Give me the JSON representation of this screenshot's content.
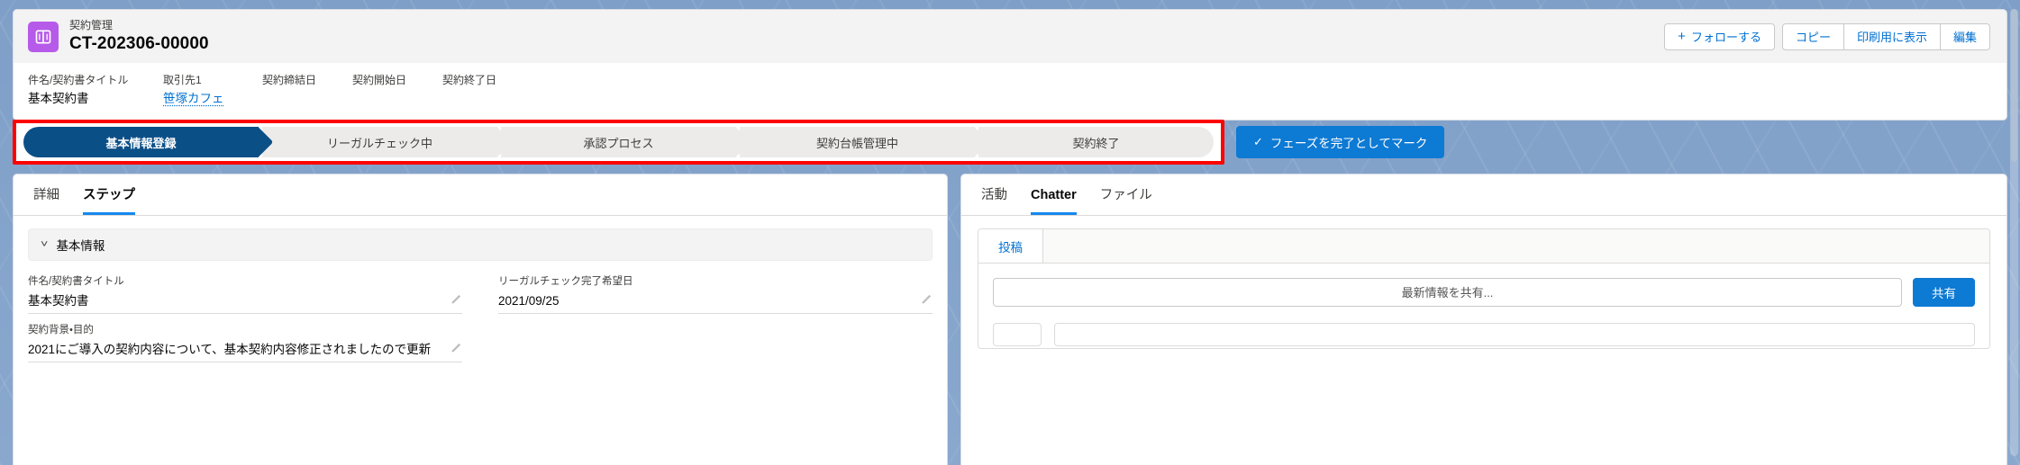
{
  "header": {
    "object_label": "契約管理",
    "record_name": "CT-202306-00000",
    "app_icon": "book-icon",
    "icon_color": "#b65ae9",
    "actions": {
      "follow": "フォローする",
      "follow_icon": "plus-icon",
      "copy": "コピー",
      "printable_view": "印刷用に表示",
      "edit": "編集"
    },
    "fields": [
      {
        "label": "件名/契約書タイトル",
        "value": "基本契約書",
        "is_link": false
      },
      {
        "label": "取引先1",
        "value": "笹塚カフェ",
        "is_link": true
      },
      {
        "label": "契約締結日",
        "value": "",
        "is_link": false
      },
      {
        "label": "契約開始日",
        "value": "",
        "is_link": false
      },
      {
        "label": "契約終了日",
        "value": "",
        "is_link": false
      }
    ]
  },
  "path": {
    "highlight_color": "#ff0000",
    "current_color": "#0b4f87",
    "stages": [
      {
        "label": "基本情報登録",
        "state": "current"
      },
      {
        "label": "リーガルチェック中",
        "state": "upcoming"
      },
      {
        "label": "承認プロセス",
        "state": "upcoming"
      },
      {
        "label": "契約台帳管理中",
        "state": "upcoming"
      },
      {
        "label": "契約終了",
        "state": "upcoming"
      }
    ],
    "mark_complete_label": "フェーズを完了としてマーク",
    "mark_complete_icon": "check-icon",
    "mark_complete_color": "#0d7ad4"
  },
  "left_panel": {
    "tabs": [
      {
        "label": "詳細",
        "active": false
      },
      {
        "label": "ステップ",
        "active": true
      }
    ],
    "section": {
      "title": "基本情報",
      "caret_icon": "chevron-down-icon"
    },
    "fields_left": [
      {
        "label": "件名/契約書タイトル",
        "value": "基本契約書",
        "edit_icon": "pencil-icon"
      },
      {
        "label": "契約背景・目的",
        "value": "2021にご導入の契約内容について、基本契約内容修正されましたので更新",
        "edit_icon": "pencil-icon"
      }
    ],
    "fields_right": [
      {
        "label": "リーガルチェック完了希望日",
        "value": "2021/09/25",
        "edit_icon": "pencil-icon"
      }
    ]
  },
  "right_panel": {
    "tabs": [
      {
        "label": "活動",
        "active": false
      },
      {
        "label": "Chatter",
        "active": true
      },
      {
        "label": "ファイル",
        "active": false
      }
    ],
    "composer": {
      "subtab": "投稿",
      "input_placeholder": "最新情報を共有...",
      "share_button": "共有",
      "share_button_color": "#0d7ad4"
    }
  }
}
